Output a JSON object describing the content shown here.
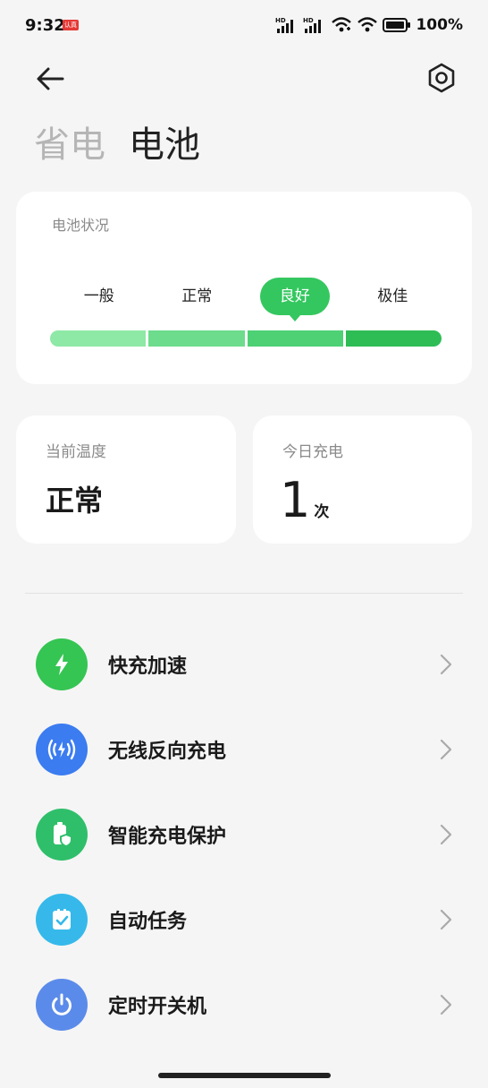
{
  "status_bar": {
    "time": "9:32",
    "badge": "认真",
    "battery_percent": "100%"
  },
  "header": {
    "back_icon": "arrow-left-icon",
    "settings_icon": "settings-hex-icon",
    "tabs": [
      {
        "label": "省电",
        "active": false
      },
      {
        "label": "电池",
        "active": true
      }
    ]
  },
  "battery_health": {
    "label": "电池状况",
    "levels": [
      "一般",
      "正常",
      "良好",
      "极佳"
    ],
    "selected_index": 2,
    "colors": [
      "#8ee8a6",
      "#6ddc8c",
      "#4dd174",
      "#2ebd55"
    ]
  },
  "temperature": {
    "label": "当前温度",
    "value": "正常"
  },
  "charge_today": {
    "label": "今日充电",
    "count": "1",
    "unit": "次"
  },
  "list": [
    {
      "label": "快充加速",
      "icon": "lightning-icon",
      "color": "#35c553"
    },
    {
      "label": "无线反向充电",
      "icon": "wireless-reverse-charge-icon",
      "color": "#3b7cf0"
    },
    {
      "label": "智能充电保护",
      "icon": "battery-shield-icon",
      "color": "#2fbf6a"
    },
    {
      "label": "自动任务",
      "icon": "task-check-icon",
      "color": "#36b9ea"
    },
    {
      "label": "定时开关机",
      "icon": "power-icon",
      "color": "#5b8bea"
    }
  ]
}
